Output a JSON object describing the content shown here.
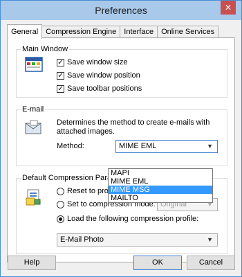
{
  "window": {
    "title": "Preferences",
    "close_label": "✕"
  },
  "tabs": [
    {
      "label": "General"
    },
    {
      "label": "Compression Engine"
    },
    {
      "label": "Interface"
    },
    {
      "label": "Online Services"
    }
  ],
  "main_window": {
    "title": "Main Window",
    "options": [
      {
        "label": "Save window size",
        "checked": true
      },
      {
        "label": "Save window position",
        "checked": true
      },
      {
        "label": "Save toolbar positions",
        "checked": true
      }
    ]
  },
  "email": {
    "title": "E-mail",
    "description_line1": "Determines the method to create e-mails with",
    "description_line2": "attached images.",
    "method_label": "Method:",
    "method_value": "MIME EML",
    "options": [
      "MAPI",
      "MIME EML",
      "MIME MSG",
      "MAILTO"
    ],
    "highlighted_option": "MIME MSG"
  },
  "compression": {
    "title": "Default Compression Paramete",
    "reset_label": "Reset to program",
    "set_mode_label": "Set to compression mode:",
    "mode_value": "Original",
    "load_profile_label": "Load the following compression profile:",
    "profile_value": "E-Mail Photo",
    "selected": "load_profile"
  },
  "buttons": {
    "help": "Help",
    "ok": "OK",
    "cancel": "Cancel"
  },
  "colors": {
    "titlebar": "#a9c9ea",
    "close": "#c75050",
    "highlight": "#3399ff"
  },
  "icons": [
    "window-icon",
    "email-icon",
    "compression-icon",
    "chevron-down-icon"
  ]
}
